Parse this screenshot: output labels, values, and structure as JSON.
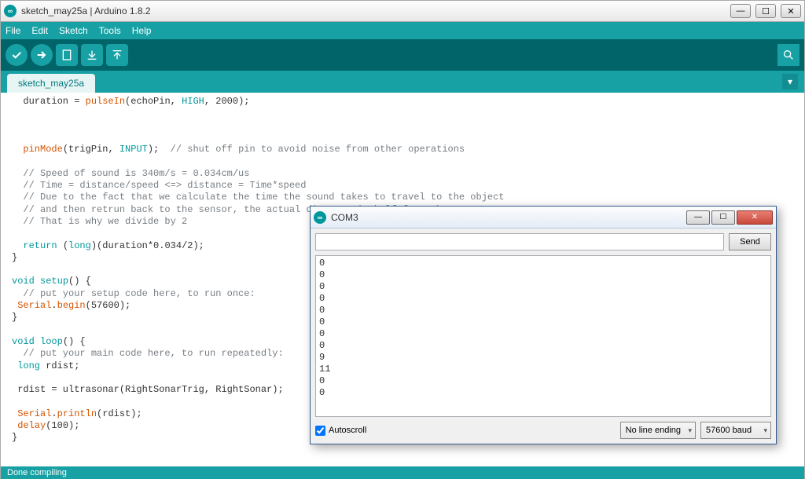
{
  "title": "sketch_may25a | Arduino 1.8.2",
  "menu": {
    "file": "File",
    "edit": "Edit",
    "sketch": "Sketch",
    "tools": "Tools",
    "help": "Help"
  },
  "tab": {
    "name": "sketch_may25a"
  },
  "status": "Done compiling",
  "code": {
    "l1a": "  duration = ",
    "l1b": "pulseIn",
    "l1c": "(echoPin, ",
    "l1d": "HIGH",
    "l1e": ", 2000);",
    "l5a": "  ",
    "l5b": "pinMode",
    "l5c": "(trigPin, ",
    "l5d": "INPUT",
    "l5e": ");  ",
    "l5f": "// shut off pin to avoid noise from other operations",
    "l7": "  // Speed of sound is 340m/s = 0.034cm/us",
    "l8": "  // Time = distance/speed <=> distance = Time*speed",
    "l9": "  // Due to the fact that we calculate the time the sound takes to travel to the object",
    "l10": "  // and then retrun back to the sensor, the actual distance is half from that we measure",
    "l11": "  // That is why we divide by 2",
    "l13a": "  ",
    "l13b": "return",
    "l13c": " (",
    "l13d": "long",
    "l13e": ")(duration*0.034/2);",
    "l14": "}",
    "l16a": "void",
    "l16b": " ",
    "l16c": "setup",
    "l16d": "() {",
    "l17": "  // put your setup code here, to run once:",
    "l18a": " ",
    "l18b": "Serial",
    "l18c": ".",
    "l18d": "begin",
    "l18e": "(57600);",
    "l19": "}",
    "l21a": "void",
    "l21b": " ",
    "l21c": "loop",
    "l21d": "() {",
    "l22": "  // put your main code here, to run repeatedly:",
    "l23a": " ",
    "l23b": "long",
    "l23c": " rdist;",
    "l25": " rdist = ultrasonar(RightSonarTrig, RightSonar);",
    "l27a": " ",
    "l27b": "Serial",
    "l27c": ".",
    "l27d": "println",
    "l27e": "(rdist);",
    "l28a": " ",
    "l28b": "delay",
    "l28c": "(100);",
    "l29": "}"
  },
  "serial": {
    "title": "COM3",
    "send_label": "Send",
    "output": "0\n0\n0\n0\n0\n0\n0\n0\n9\n11\n0\n0",
    "autoscroll_label": "Autoscroll",
    "line_ending": "No line ending",
    "baud": "57600 baud"
  },
  "icons": {
    "min": "—",
    "max": "☐",
    "close": "✕",
    "infinity": "∞"
  }
}
